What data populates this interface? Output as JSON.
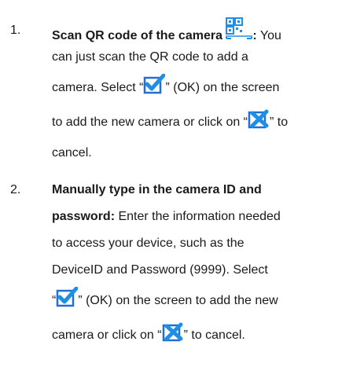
{
  "items": [
    {
      "number": "1.",
      "heading": "Scan QR code of the camera",
      "icon_qr": "qr-scan-icon",
      "colon": ":",
      "line1_tail": " You",
      "line2": "can just scan the QR code to add a",
      "line3_pre": "camera. Select “",
      "ok_icon": "checkmark-icon",
      "line3_post": "” (OK) on the screen",
      "line4_pre": "to add the new camera or click on “",
      "cancel_icon": "cancel-x-icon",
      "line4_post": "” to",
      "line5": "cancel."
    },
    {
      "number": "2.",
      "heading_line1": "Manually type in the camera ID and",
      "heading_line2": "password:",
      "line2_tail": " Enter the information needed",
      "line3": "to access your device, such as the",
      "line4": "DeviceID and Password (9999). Select",
      "line5_pre": "“",
      "ok_icon": "checkmark-icon",
      "line5_post": "” (OK) on the screen to add the new",
      "line6_pre": "camera or click on “",
      "cancel_icon": "cancel-x-icon",
      "line6_post": "” to cancel."
    }
  ],
  "colors": {
    "text": "#1a1a1a",
    "icon_blue": "#1f8fe6",
    "icon_border": "#1f6fd6"
  }
}
